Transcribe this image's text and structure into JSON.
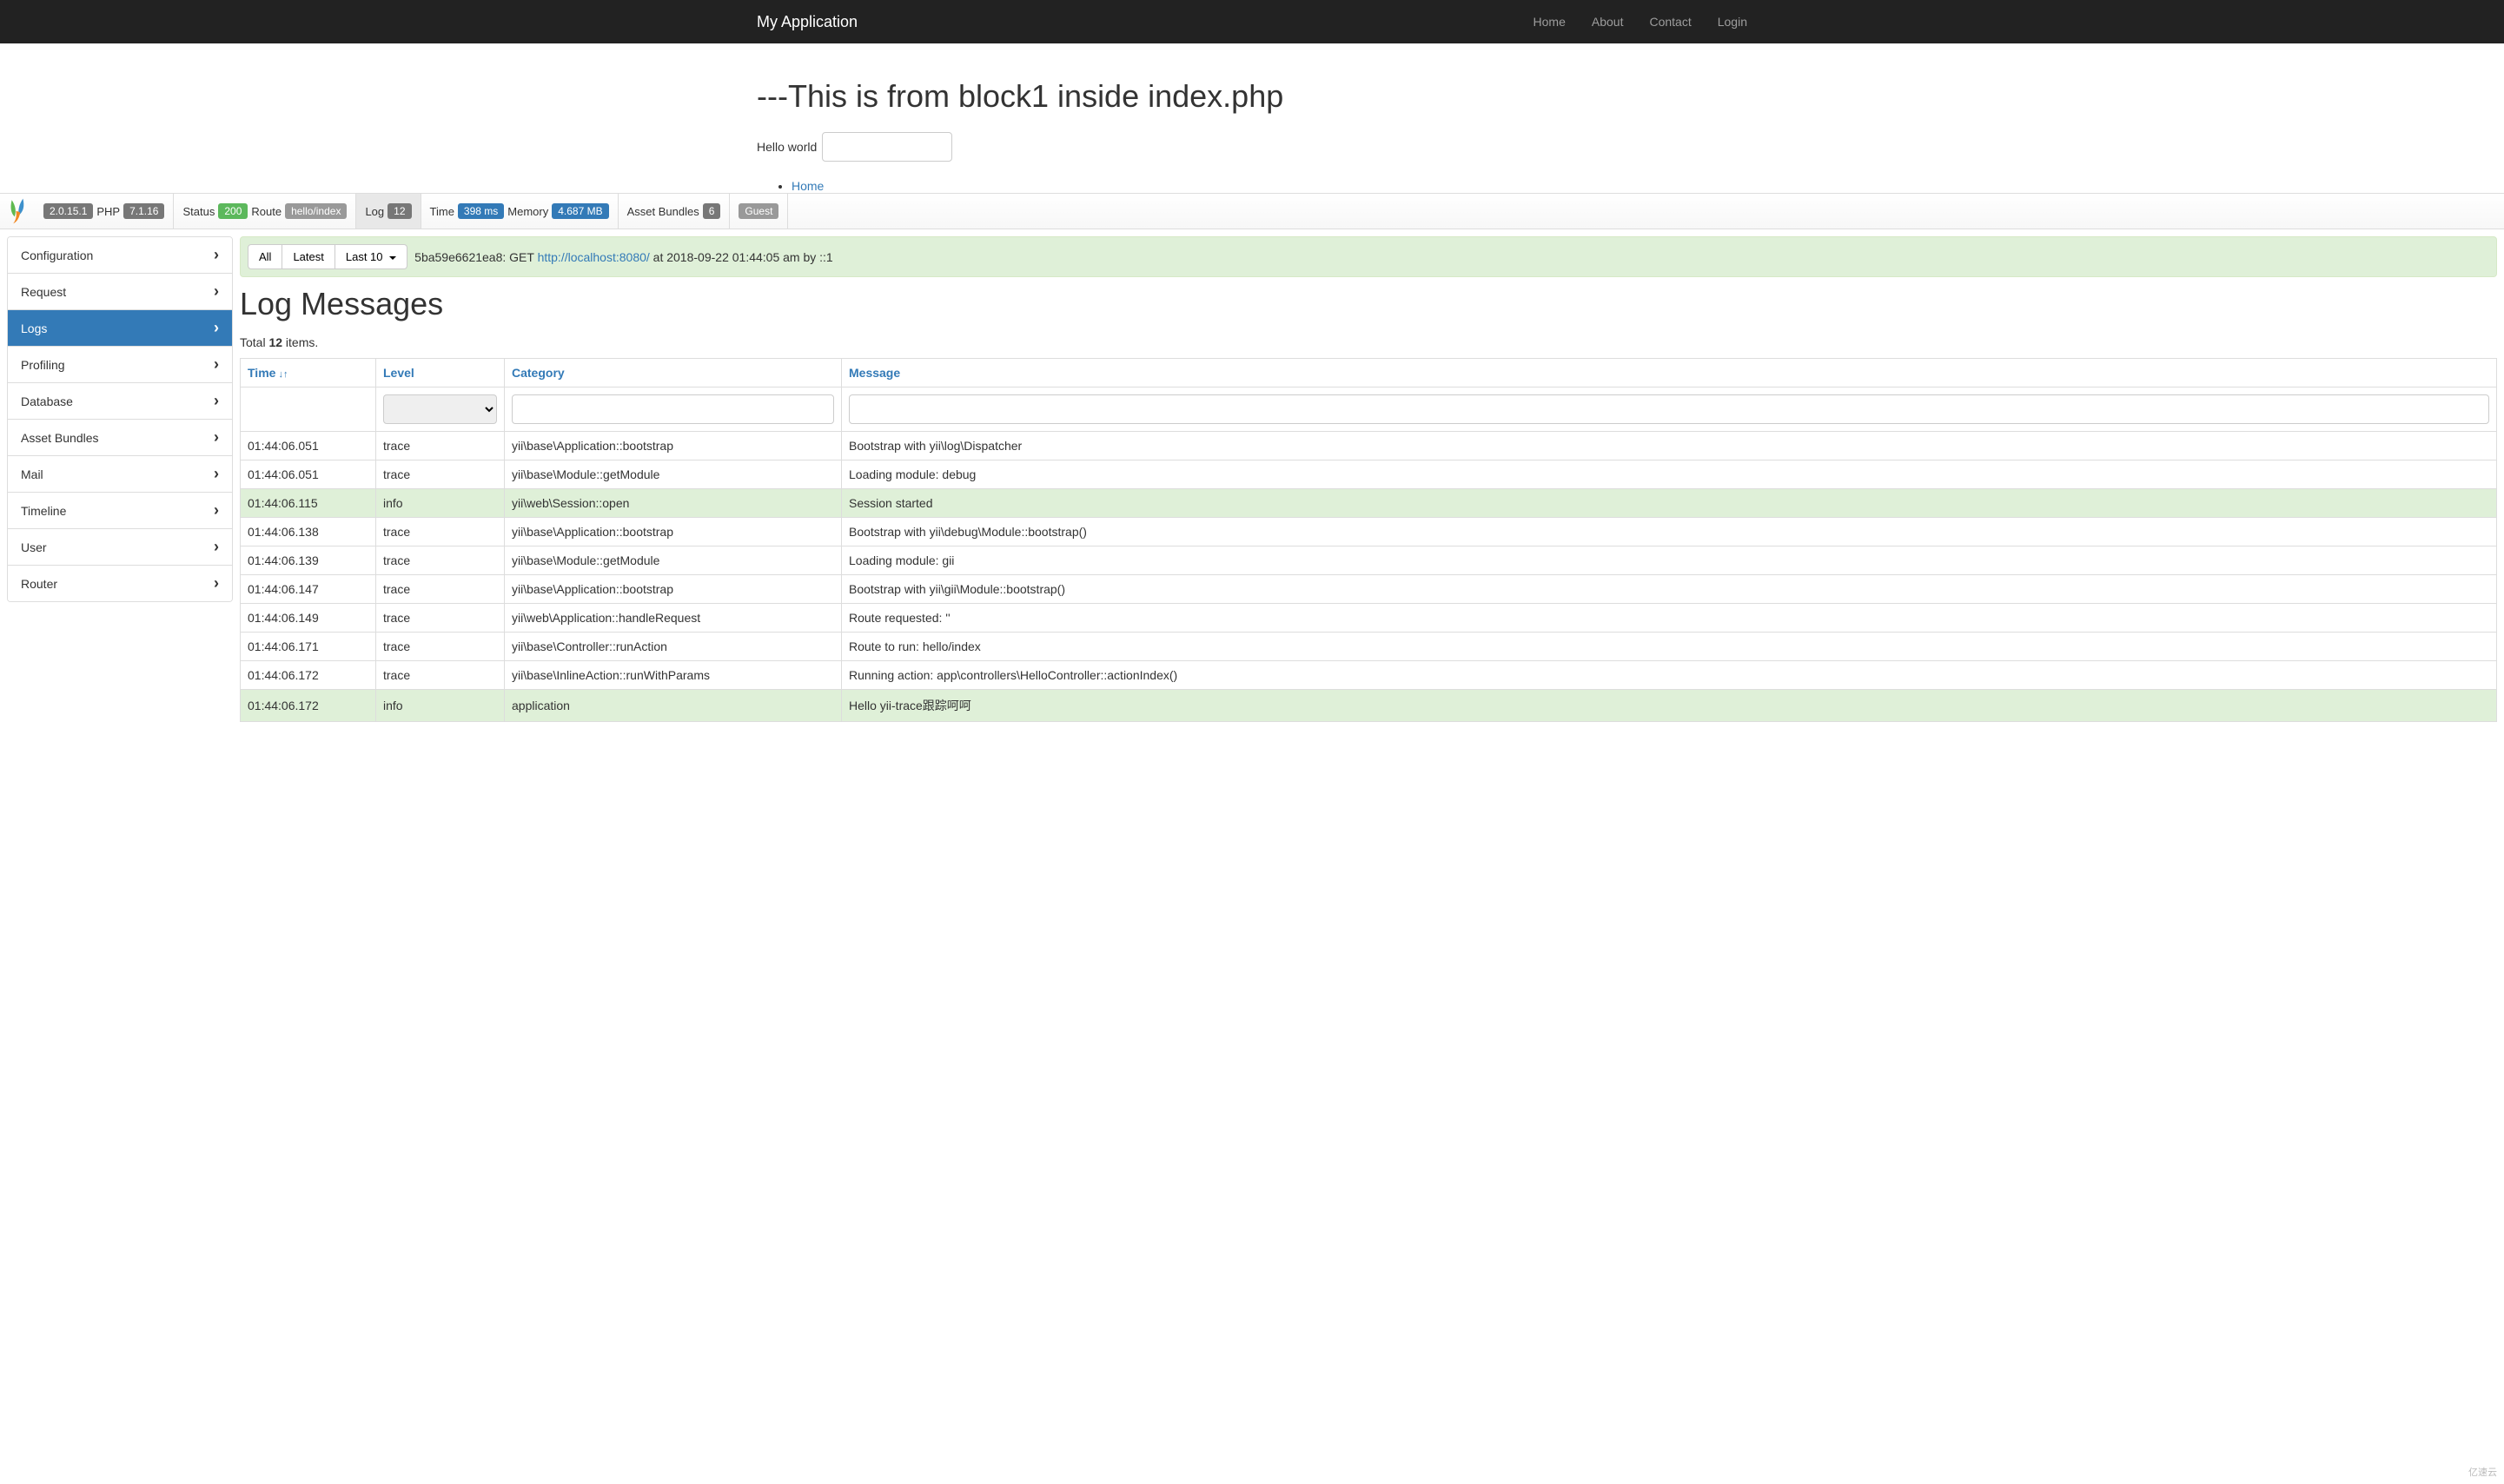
{
  "navbar": {
    "brand": "My Application",
    "links": [
      "Home",
      "About",
      "Contact",
      "Login"
    ]
  },
  "page": {
    "heading": "---This is from block1 inside index.php",
    "hello_text": "Hello world",
    "sublink": "Home"
  },
  "toolbar": {
    "yii_version": "2.0.15.1",
    "php_label": "PHP",
    "php_version": "7.1.16",
    "status_label": "Status",
    "status_code": "200",
    "route_label": "Route",
    "route_value": "hello/index",
    "log_label": "Log",
    "log_count": "12",
    "time_label": "Time",
    "time_value": "398 ms",
    "memory_label": "Memory",
    "memory_value": "4.687 MB",
    "assets_label": "Asset Bundles",
    "assets_count": "6",
    "user_label": "Guest"
  },
  "sidebar": {
    "items": [
      "Configuration",
      "Request",
      "Logs",
      "Profiling",
      "Database",
      "Asset Bundles",
      "Mail",
      "Timeline",
      "User",
      "Router"
    ],
    "active_index": 2
  },
  "request_bar": {
    "btn_all": "All",
    "btn_latest": "Latest",
    "btn_last10": "Last 10",
    "hash": "5ba59e6621ea8:",
    "method": "GET",
    "url": "http://localhost:8080/",
    "suffix": "at 2018-09-22 01:44:05 am by ::1"
  },
  "logs": {
    "title": "Log Messages",
    "summary_prefix": "Total ",
    "summary_count": "12",
    "summary_suffix": " items.",
    "columns": {
      "time": "Time",
      "level": "Level",
      "category": "Category",
      "message": "Message"
    },
    "rows": [
      {
        "time": "01:44:06.051",
        "level": "trace",
        "category": "yii\\base\\Application::bootstrap",
        "message": "Bootstrap with yii\\log\\Dispatcher"
      },
      {
        "time": "01:44:06.051",
        "level": "trace",
        "category": "yii\\base\\Module::getModule",
        "message": "Loading module: debug"
      },
      {
        "time": "01:44:06.115",
        "level": "info",
        "category": "yii\\web\\Session::open",
        "message": "Session started"
      },
      {
        "time": "01:44:06.138",
        "level": "trace",
        "category": "yii\\base\\Application::bootstrap",
        "message": "Bootstrap with yii\\debug\\Module::bootstrap()"
      },
      {
        "time": "01:44:06.139",
        "level": "trace",
        "category": "yii\\base\\Module::getModule",
        "message": "Loading module: gii"
      },
      {
        "time": "01:44:06.147",
        "level": "trace",
        "category": "yii\\base\\Application::bootstrap",
        "message": "Bootstrap with yii\\gii\\Module::bootstrap()"
      },
      {
        "time": "01:44:06.149",
        "level": "trace",
        "category": "yii\\web\\Application::handleRequest",
        "message": "Route requested: ''"
      },
      {
        "time": "01:44:06.171",
        "level": "trace",
        "category": "yii\\base\\Controller::runAction",
        "message": "Route to run: hello/index"
      },
      {
        "time": "01:44:06.172",
        "level": "trace",
        "category": "yii\\base\\InlineAction::runWithParams",
        "message": "Running action: app\\controllers\\HelloController::actionIndex()"
      },
      {
        "time": "01:44:06.172",
        "level": "info",
        "category": "application",
        "message": "Hello yii-trace跟踪呵呵"
      }
    ]
  },
  "watermark": "亿速云"
}
